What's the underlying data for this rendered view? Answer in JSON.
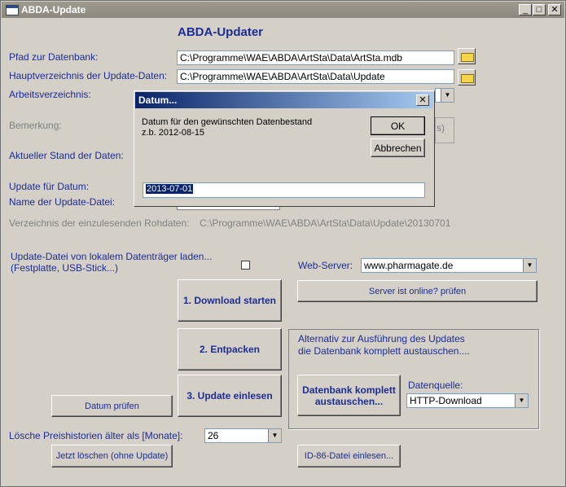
{
  "window": {
    "title": "ABDA-Update",
    "min": "_",
    "max": "□",
    "close": "✕"
  },
  "header": "ABDA-Updater",
  "labels": {
    "db_path": "Pfad zur Datenbank:",
    "update_root": "Hauptverzeichnis der Update-Daten:",
    "work_dir": "Arbeitsverzeichnis:",
    "remark": "Bemerkung:",
    "current_state": "Aktueller Stand der Daten:",
    "update_date": "Update für Datum:",
    "update_file": "Name der Update-Datei:",
    "raw_dir_label": "Verzeichnis der einzulesenden Rohdaten:",
    "raw_dir_value": "C:\\Programme\\WAE\\ABDA\\ArtSta\\Data\\Update\\20130701",
    "local_load": "Update-Datei von lokalem Datenträger laden...",
    "local_load2": "(Festplatte, USB-Stick...)",
    "web_server": "Web-Server:",
    "alt_line1": "Alternativ zur Ausführung des Updates",
    "alt_line2": "die Datenbank komplett austauschen....",
    "data_source": "Datenquelle:",
    "delete_history": "Lösche Preishistorien älter als [Monate]:",
    "remark_partial": "s)"
  },
  "fields": {
    "db_path": "C:\\Programme\\WAE\\ABDA\\ArtSta\\Data\\ArtSta.mdb",
    "update_root": "C:\\Programme\\WAE\\ABDA\\ArtSta\\Data\\Update",
    "web_server": "www.pharmagate.de",
    "data_source": "HTTP-Download",
    "months": "26"
  },
  "buttons": {
    "download": "1. Download starten",
    "unpack": "2. Entpacken",
    "import": "3. Update einlesen",
    "check_date": "Datum prüfen",
    "server_online": "Server ist online? prüfen",
    "replace_db": "Datenbank komplett austauschen...",
    "delete_now": "Jetzt löschen (ohne Update)",
    "id86": "ID-86-Datei einlesen..."
  },
  "dialog": {
    "title": "Datum...",
    "close": "✕",
    "line1": "Datum für den gewünschten Datenbestand",
    "line2": "z.b. 2012-08-15",
    "ok": "OK",
    "cancel": "Abbrechen",
    "input_value": "2013-07-01"
  }
}
